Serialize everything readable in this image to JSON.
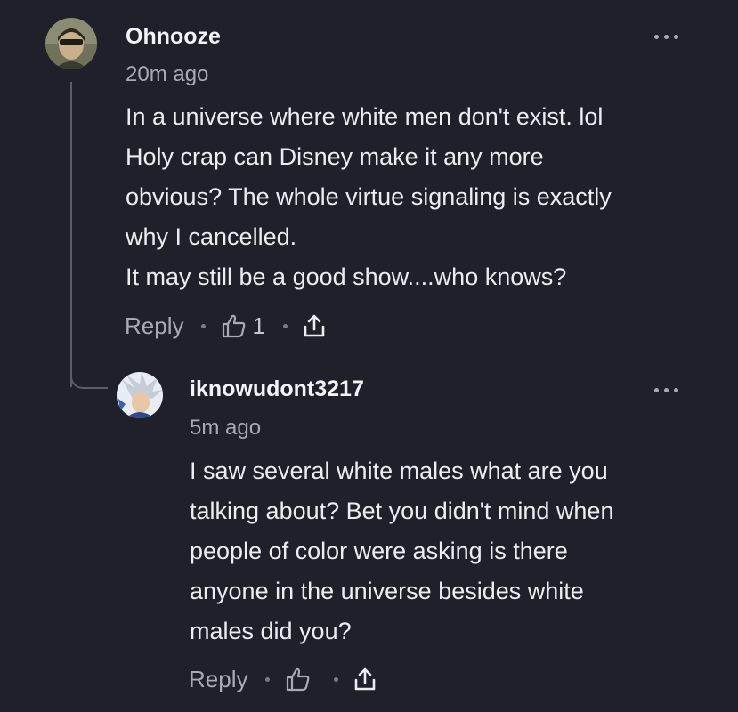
{
  "comments": [
    {
      "username": "Ohnooze",
      "time": "20m ago",
      "lines": [
        "In a universe where white men don't exist. lol",
        "Holy crap can Disney make it any more",
        "obvious?  The whole virtue signaling is exactly",
        "why I cancelled.",
        "It may still be a good show....who knows?"
      ],
      "reply_label": "Reply",
      "like_count": "1",
      "avatar": "avatar"
    },
    {
      "username": "iknowudont3217",
      "time": "5m ago",
      "lines": [
        "I saw several white males what are you",
        "talking about? Bet you didn't mind when",
        "people of color were asking is there",
        "anyone in the universe besides white",
        "males did you?"
      ],
      "reply_label": "Reply",
      "like_count": "",
      "avatar": "avatar"
    }
  ],
  "icons": {
    "more": "more-options-icon",
    "like": "thumbs-up-icon",
    "share": "share-icon"
  },
  "colors": {
    "background": "#1f2029",
    "text": "#ecedf0",
    "muted": "#a9abb3",
    "thread_line": "#5b5d66"
  }
}
